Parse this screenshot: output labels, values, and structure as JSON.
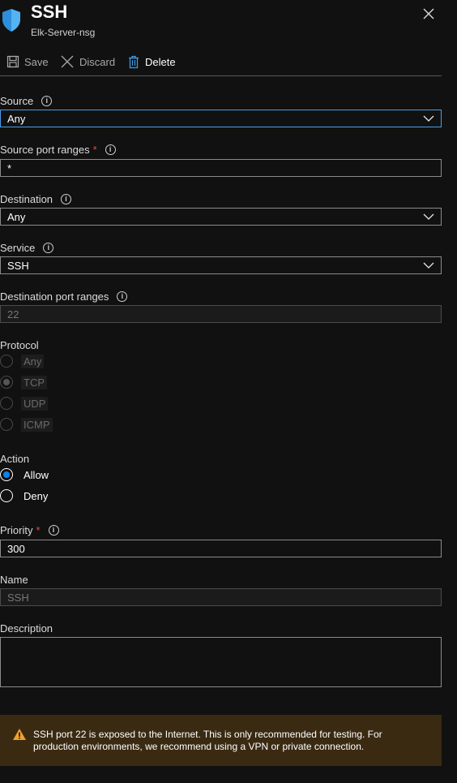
{
  "header": {
    "title": "SSH",
    "subtitle": "Elk-Server-nsg"
  },
  "toolbar": {
    "save_label": "Save",
    "discard_label": "Discard",
    "delete_label": "Delete"
  },
  "fields": {
    "source": {
      "label": "Source",
      "value": "Any"
    },
    "source_port_ranges": {
      "label": "Source port ranges",
      "required_mark": "*",
      "value": "*"
    },
    "destination": {
      "label": "Destination",
      "value": "Any"
    },
    "service": {
      "label": "Service",
      "value": "SSH"
    },
    "destination_port_ranges": {
      "label": "Destination port ranges",
      "value": "22"
    },
    "protocol": {
      "label": "Protocol",
      "options": [
        "Any",
        "TCP",
        "UDP",
        "ICMP"
      ],
      "selected": "TCP"
    },
    "action": {
      "label": "Action",
      "options": [
        "Allow",
        "Deny"
      ],
      "selected": "Allow"
    },
    "priority": {
      "label": "Priority",
      "required_mark": "*",
      "value": "300"
    },
    "name": {
      "label": "Name",
      "value": "SSH"
    },
    "description": {
      "label": "Description",
      "value": ""
    }
  },
  "info_glyph": "i",
  "warning": {
    "text": "SSH port 22 is exposed to the Internet. This is only recommended for testing. For production environments, we recommend using a VPN or private connection."
  },
  "colors": {
    "accent": "#0f83e6",
    "warning_bg": "#3a2a12",
    "warning_icon": "#f0a030",
    "required": "#e04a4a"
  }
}
